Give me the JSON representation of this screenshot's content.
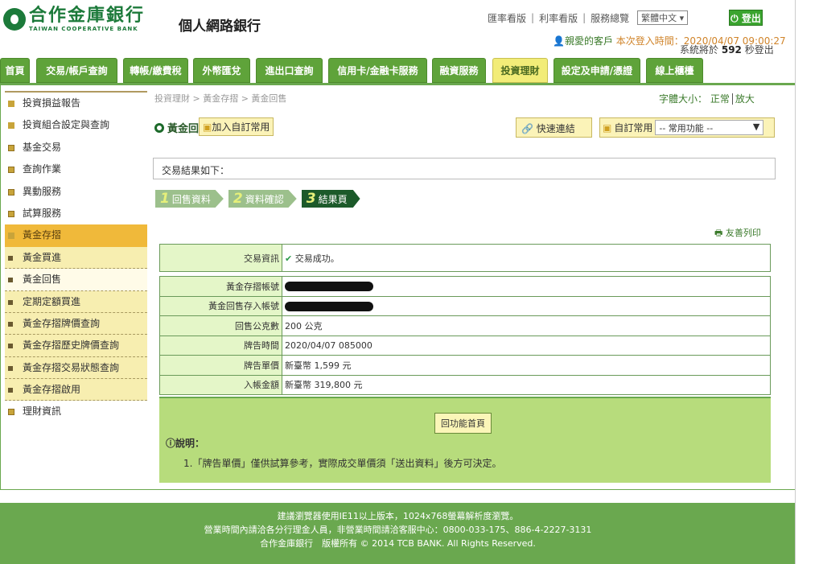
{
  "header": {
    "logo_cn": "合作金庫銀行",
    "logo_en": "TAIWAN COOPERATIVE BANK",
    "app_title": "個人網路銀行",
    "links": [
      "匯率看版",
      "利率看版",
      "服務總覽"
    ],
    "language": "繁體中文",
    "logout": "登出",
    "welcome": "親愛的客戶",
    "login_time": "本次登入時間：2020/04/07 09:00:27",
    "countdown_prefix": "系統將於",
    "countdown_seconds": "592",
    "countdown_suffix": "秒登出"
  },
  "nav": {
    "tabs": [
      "首頁",
      "交易/帳戶查詢",
      "轉帳/繳費稅",
      "外幣匯兌",
      "進出口查詢",
      "信用卡/金融卡服務",
      "融資服務",
      "投資理財",
      "設定及申請/憑證",
      "線上櫃檯"
    ],
    "active": "投資理財"
  },
  "sidebar": {
    "items": [
      "投資損益報告",
      "投資組合設定與查詢",
      "基金交易",
      "查詢作業",
      "異動服務",
      "試算服務",
      "黃金存摺"
    ],
    "sub": [
      "黃金買進",
      "黃金回售",
      "定期定額買進",
      "黃金存摺牌價查詢",
      "黃金存摺歷史牌價查詢",
      "黃金存摺交易狀態查詢",
      "黃金存摺啟用"
    ],
    "after": "理財資訊"
  },
  "main": {
    "breadcrumb": "投資理財 > 黃金存摺 > 黃金回售",
    "font_label": "字體大小：",
    "font_normal": "正常",
    "font_large": "放大",
    "title": "黃金回售",
    "add_fav": "加入自訂常用",
    "quick_link": "快速連結",
    "custom_label": "自訂常用",
    "custom_select": "-- 常用功能 --",
    "message": "交易結果如下：",
    "steps": [
      "回售資料",
      "資料確認",
      "結果頁"
    ],
    "print": "友善列印",
    "status_label": "交易資訊",
    "status_value": "交易成功。",
    "rows": [
      {
        "label": "黃金存摺帳號",
        "value": ""
      },
      {
        "label": "黃金回售存入帳號",
        "value": ""
      },
      {
        "label": "回售公克數",
        "value": "200 公克"
      },
      {
        "label": "牌告時間",
        "value": "2020/04/07 085000"
      },
      {
        "label": "牌告單價",
        "value": "新臺幣 1,599 元"
      },
      {
        "label": "入帳金額",
        "value": "新臺幣 319,800 元"
      }
    ],
    "back": "回功能首頁",
    "note_title": "說明：",
    "note1": "1.「牌告單價」僅供試算參考，實際成交單價須「送出資料」後方可決定。"
  },
  "footer": {
    "line1": "建議瀏覽器使用IE11以上版本，1024x768螢幕解析度瀏覽。",
    "line2": "營業時間內請洽各分行理金人員，非營業時間請洽客服中心：0800-033-175、886-4-2227-3131",
    "line3": "合作金庫銀行　版權所有 © 2014 TCB BANK. All Rights Reserved."
  }
}
